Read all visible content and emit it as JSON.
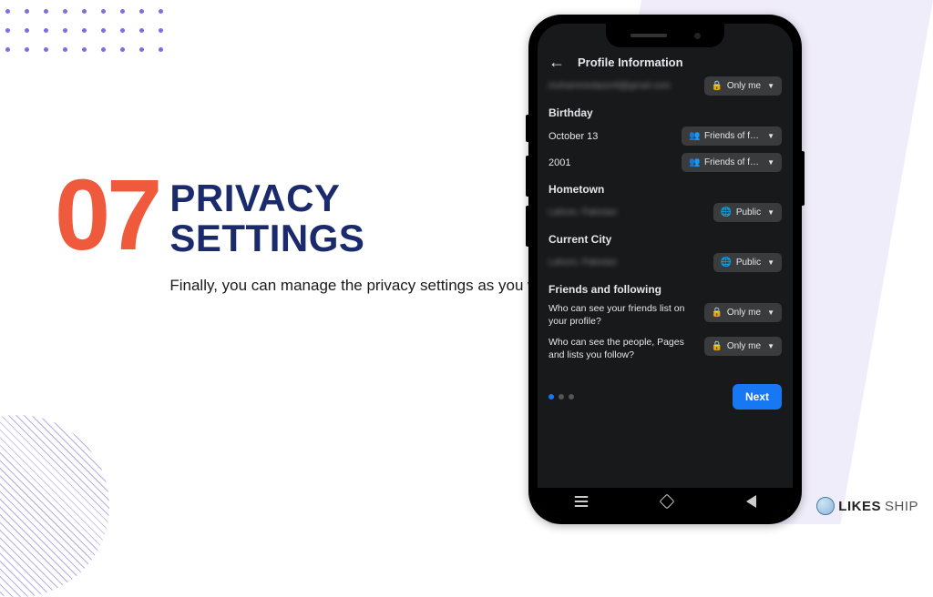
{
  "slide": {
    "step_number": "07",
    "title_line1": "PRIVACY",
    "title_line2": "SETTINGS",
    "subtitle": "Finally, you can manage the privacy settings as you want."
  },
  "logo": {
    "text_a": "LIKES",
    "text_b": "SHIP"
  },
  "app": {
    "header_title": "Profile Information",
    "email_row": {
      "blurred_text": "mohammedazer8@gmail.com",
      "privacy_label": "Only me",
      "privacy_icon": "lock"
    },
    "birthday": {
      "section_title": "Birthday",
      "date_value": "October 13",
      "date_privacy_label": "Friends of frie…",
      "date_privacy_icon": "friends",
      "year_value": "2001",
      "year_privacy_label": "Friends of frie…",
      "year_privacy_icon": "friends"
    },
    "hometown": {
      "section_title": "Hometown",
      "blurred_text": "Lahore, Pakistan",
      "privacy_label": "Public",
      "privacy_icon": "globe"
    },
    "current_city": {
      "section_title": "Current City",
      "blurred_text": "Lahore, Pakistan",
      "privacy_label": "Public",
      "privacy_icon": "globe"
    },
    "friends": {
      "section_title": "Friends and following",
      "q1": "Who can see your friends list on your profile?",
      "q1_privacy_label": "Only me",
      "q1_privacy_icon": "lock",
      "q2": "Who can see the people, Pages and lists you follow?",
      "q2_privacy_label": "Only me",
      "q2_privacy_icon": "lock"
    },
    "next_button": "Next"
  },
  "icons": {
    "lock": "🔒",
    "friends": "👥",
    "globe": "🌐"
  }
}
